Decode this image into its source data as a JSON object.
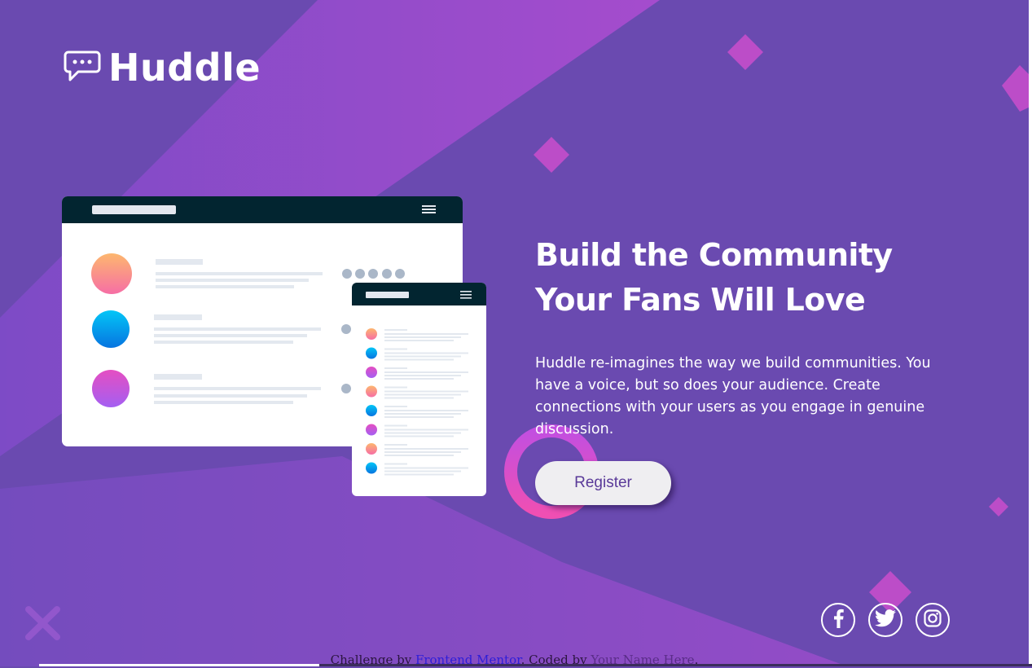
{
  "brand": {
    "name": "Huddle"
  },
  "hero": {
    "title": "Build the Community Your Fans Will Love",
    "text": "Huddle re-imagines the way we build communities. You have a voice, but so does your audience. Create connections with your users as you engage in genuine discussion.",
    "register_label": "Register"
  },
  "social": {
    "items": [
      {
        "icon": "facebook-icon"
      },
      {
        "icon": "twitter-icon"
      },
      {
        "icon": "instagram-icon"
      }
    ]
  },
  "footer": {
    "prefix": "Challenge by ",
    "challenge_link": "Frontend Mentor",
    "middle": ". Coded by ",
    "author_link": "Your Name Here",
    "suffix": "."
  },
  "colors": {
    "background": "#6a4ab0",
    "accent_pink": "#d64fd6",
    "button_bg": "#efeef1",
    "button_text": "#5a3a99",
    "mockup_header": "#022530"
  }
}
